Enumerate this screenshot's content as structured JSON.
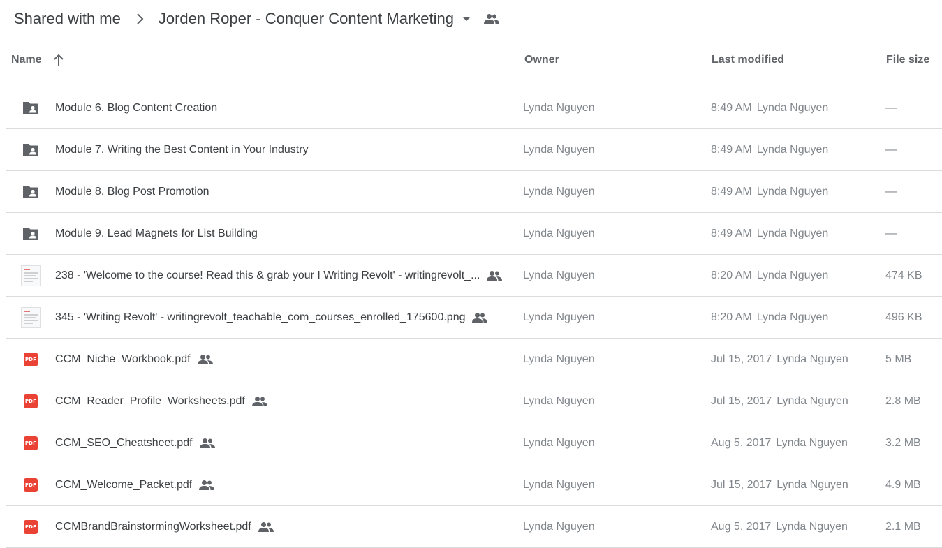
{
  "breadcrumb": {
    "root": "Shared with me",
    "current": "Jorden Roper - Conquer Content Marketing"
  },
  "columns": {
    "name": "Name",
    "owner": "Owner",
    "last_modified": "Last modified",
    "file_size": "File size"
  },
  "rows": [
    {
      "icon": "shared-folder-icon",
      "name": "Module 6. Blog Content Creation",
      "shared": false,
      "owner": "Lynda Nguyen",
      "modified": "8:49 AM",
      "modified_by": "Lynda Nguyen",
      "size": "—"
    },
    {
      "icon": "shared-folder-icon",
      "name": "Module 7. Writing the Best Content in Your Industry",
      "shared": false,
      "owner": "Lynda Nguyen",
      "modified": "8:49 AM",
      "modified_by": "Lynda Nguyen",
      "size": "—"
    },
    {
      "icon": "shared-folder-icon",
      "name": "Module 8. Blog Post Promotion",
      "shared": false,
      "owner": "Lynda Nguyen",
      "modified": "8:49 AM",
      "modified_by": "Lynda Nguyen",
      "size": "—"
    },
    {
      "icon": "shared-folder-icon",
      "name": "Module 9. Lead Magnets for List Building",
      "shared": false,
      "owner": "Lynda Nguyen",
      "modified": "8:49 AM",
      "modified_by": "Lynda Nguyen",
      "size": "—"
    },
    {
      "icon": "image-thumbnail-icon",
      "name": "238 - 'Welcome to the course! Read this & grab your I Writing Revolt' - writingrevolt_...",
      "shared": true,
      "owner": "Lynda Nguyen",
      "modified": "8:20 AM",
      "modified_by": "Lynda Nguyen",
      "size": "474 KB"
    },
    {
      "icon": "image-thumbnail-icon",
      "name": "345 - 'Writing Revolt' - writingrevolt_teachable_com_courses_enrolled_175600.png",
      "shared": true,
      "owner": "Lynda Nguyen",
      "modified": "8:20 AM",
      "modified_by": "Lynda Nguyen",
      "size": "496 KB"
    },
    {
      "icon": "pdf-icon",
      "name": "CCM_Niche_Workbook.pdf",
      "shared": true,
      "owner": "Lynda Nguyen",
      "modified": "Jul 15, 2017",
      "modified_by": "Lynda Nguyen",
      "size": "5 MB"
    },
    {
      "icon": "pdf-icon",
      "name": "CCM_Reader_Profile_Worksheets.pdf",
      "shared": true,
      "owner": "Lynda Nguyen",
      "modified": "Jul 15, 2017",
      "modified_by": "Lynda Nguyen",
      "size": "2.8 MB"
    },
    {
      "icon": "pdf-icon",
      "name": "CCM_SEO_Cheatsheet.pdf",
      "shared": true,
      "owner": "Lynda Nguyen",
      "modified": "Aug 5, 2017",
      "modified_by": "Lynda Nguyen",
      "size": "3.2 MB"
    },
    {
      "icon": "pdf-icon",
      "name": "CCM_Welcome_Packet.pdf",
      "shared": true,
      "owner": "Lynda Nguyen",
      "modified": "Jul 15, 2017",
      "modified_by": "Lynda Nguyen",
      "size": "4.9 MB"
    },
    {
      "icon": "pdf-icon",
      "name": "CCMBrandBrainstormingWorksheet.pdf",
      "shared": true,
      "owner": "Lynda Nguyen",
      "modified": "Aug 5, 2017",
      "modified_by": "Lynda Nguyen",
      "size": "2.1 MB"
    }
  ],
  "pdf_badge_text": "PDF",
  "colors": {
    "text": "#3c4043",
    "muted": "#80868b",
    "icon": "#5f6368",
    "divider": "#dadce0",
    "pdf_red": "#ea4335"
  }
}
